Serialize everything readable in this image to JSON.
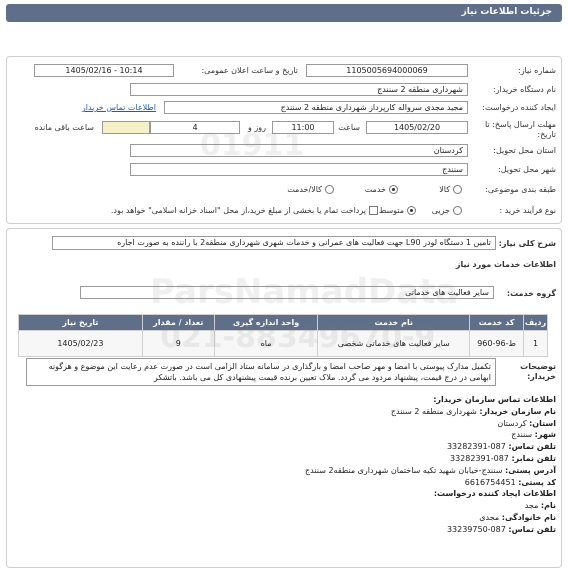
{
  "header": {
    "title": "جزئیات اطلاعات نیاز"
  },
  "form": {
    "need_number_label": "شماره نیاز:",
    "need_number_value": "1105005694000069",
    "announce_label": "تاریخ و ساعت اعلان عمومی:",
    "announce_value": "1405/02/16 - 10:14",
    "buyer_label": "نام دستگاه خریدار:",
    "buyer_value": "شهرداری منطقه 2 سنندج",
    "creator_label": "ایجاد کننده درخواست:",
    "creator_value": "مجید مجدی سرواله کارپرداز شهرداری منطقه 2 سنندج",
    "buyer_contact_link": "اطلاعات تماس خریدار",
    "deadline_label": "مهلت ارسال پاسخ: تا تاریخ:",
    "deadline_date": "1405/02/20",
    "time_label": "ساعت",
    "deadline_time": "11:00",
    "days_value": "4",
    "days_label": "روز و",
    "remaining_label": "ساعت باقی مانده",
    "province_label": "استان محل تحویل:",
    "province_value": "کردستان",
    "city_label": "شهر محل تحویل:",
    "city_value": "سنندج",
    "category_label": "طبقه بندی موضوعی:",
    "category_options": [
      "کالا",
      "خدمت",
      "کالا/خدمت"
    ],
    "category_selected": "خدمت",
    "process_label": "نوع فرآیند خرید :",
    "process_options": [
      "جزیی",
      "متوسط"
    ],
    "process_selected": "متوسط",
    "payment_note": "پرداخت تمام یا بخشی از مبلغ خرید،از محل \"اسناد خزانه اسلامی\" خواهد بود."
  },
  "details": {
    "summary_label": "شرح کلی نیاز:",
    "summary_value": "تامین 1 دستگاه لودر L90 جهت فعالیت های عمرانی و خدمات شهری شهرداری منطقه2 با راننده به صورت اجاره",
    "services_title": "اطلاعات خدمات مورد نیاز",
    "group_label": "گروه خدمت:",
    "group_value": "سایر فعالیت های خدماتی",
    "table_headers": [
      "ردیف",
      "کد خدمت",
      "نام خدمت",
      "واحد اندازه گیری",
      "تعداد / مقدار",
      "تاریخ نیاز"
    ],
    "table_rows": [
      [
        "1",
        "ط-96-960",
        "سایر فعالیت های خدماتی شخصی",
        "ماه",
        "9",
        "1405/02/23"
      ]
    ],
    "buyer_notes_label": "توضیحات خریدار:",
    "buyer_notes_value": "تکمیل مدارک پیوستی با امضا و مهر صاحب امضا و بارگذاری در سامانه ستاد الزامی است در صورت عدم رعایت این موضوع و هرگونه ابهامی در درج قیمت، پیشنهاد مردود می گردد. ملاک تعیین برنده قیمت پیشنهادی کل می باشد. باتشکر"
  },
  "contact": {
    "title": "اطلاعات تماس سازمان خریدار:",
    "org_name_label": "نام سازمان خریدار:",
    "org_name_value": "شهرداری منطقه 2 سنندج",
    "province_label": "استان:",
    "province_value": "کردستان",
    "city_label": "شهر:",
    "city_value": "سنندج",
    "phone_label": "تلفن تماس:",
    "phone_value": "087-33282391",
    "fax_label": "تلفن نمابر:",
    "fax_value": "087-33282391",
    "address_label": "آدرس پستی:",
    "address_value": "سنندج-خیابان شهید تکیه ساختمان شهرداری منطقه2 سنندج",
    "postal_label": "کد پستی:",
    "postal_value": "6616754451",
    "creator_title": "اطلاعات ایجاد کننده درخواست:",
    "first_name_label": "نام:",
    "first_name_value": "مجد",
    "last_name_label": "نام خانوادگی:",
    "last_name_value": "مجدی",
    "creator_phone_label": "تلفن تماس:",
    "creator_phone_value": "087-33239750"
  },
  "watermark": {
    "site": "ParsNamadData",
    "phone": "021-88349670-9",
    "code": "01911"
  }
}
